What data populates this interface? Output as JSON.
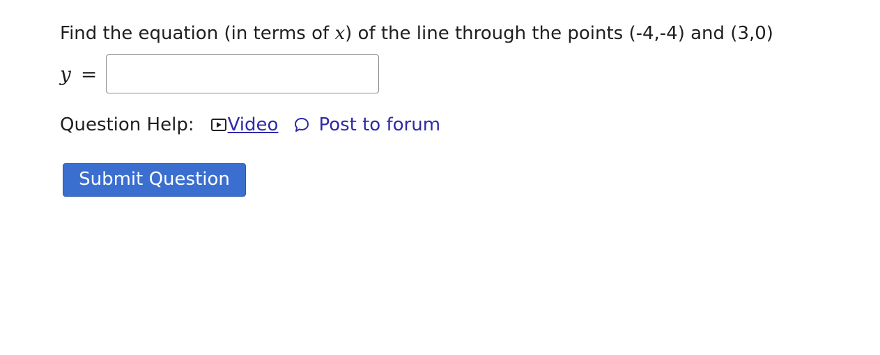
{
  "question": {
    "text_before": "Find the equation (in terms of ",
    "math_variable": "x",
    "text_after": ") of the line through the points (-4,-4) and (3,0)"
  },
  "answer": {
    "label_var": "y",
    "label_eq": "=",
    "value": ""
  },
  "help": {
    "label": "Question Help:",
    "video_label": "Video",
    "forum_label": "Post to forum"
  },
  "submit": {
    "label": "Submit Question"
  },
  "colors": {
    "link": "#2e2aa8",
    "button": "#3a6fd0",
    "button_text": "#ffffff"
  },
  "icons": {
    "video": "video-play-icon",
    "forum": "speech-bubble-icon"
  }
}
